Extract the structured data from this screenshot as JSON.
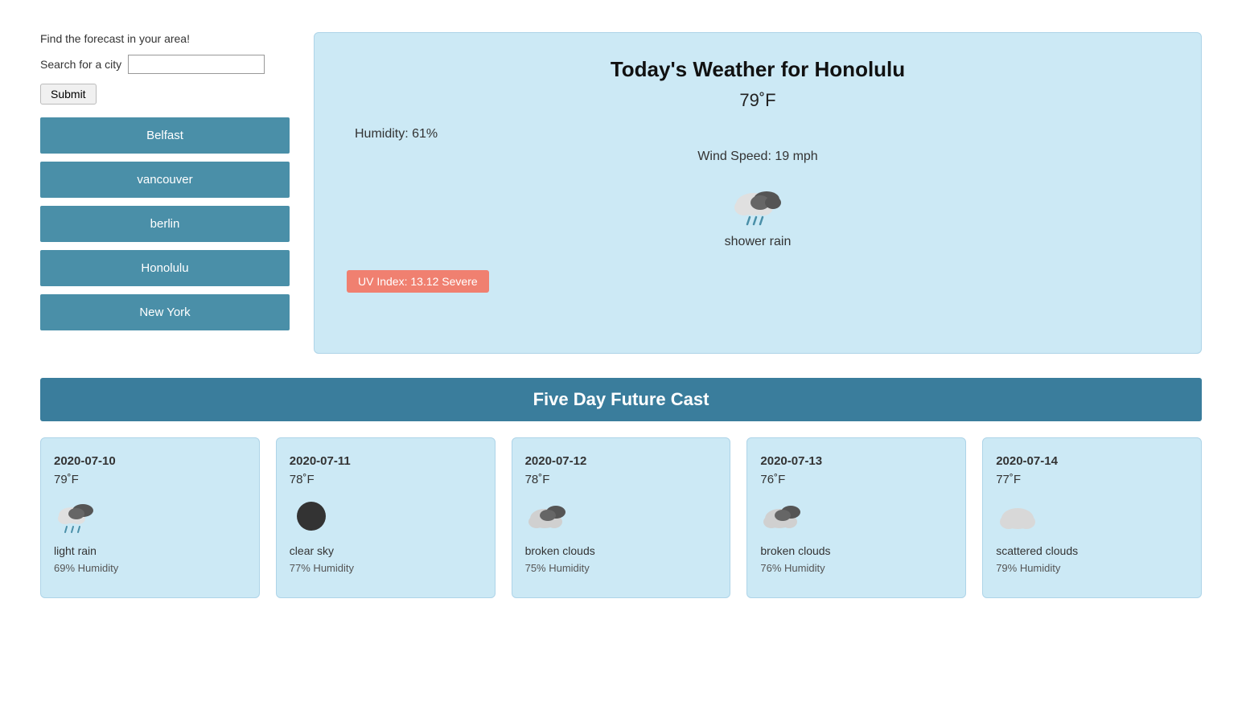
{
  "sidebar": {
    "title": "Find the forecast in your area!",
    "search_label": "Search for a city",
    "search_placeholder": "",
    "submit_label": "Submit",
    "cities": [
      {
        "label": "Belfast"
      },
      {
        "label": "vancouver"
      },
      {
        "label": "berlin"
      },
      {
        "label": "Honolulu"
      },
      {
        "label": "New York"
      }
    ]
  },
  "current_weather": {
    "title": "Today's Weather for Honolulu",
    "temp": "79˚F",
    "humidity": "Humidity: 61%",
    "wind_speed": "Wind Speed: 19 mph",
    "condition": "shower rain",
    "uv_badge": "UV Index: 13.12 Severe"
  },
  "five_day": {
    "header": "Five Day Future Cast",
    "forecasts": [
      {
        "date": "2020-07-10",
        "temp": "79˚F",
        "condition": "light rain",
        "humidity": "69% Humidity"
      },
      {
        "date": "2020-07-11",
        "temp": "78˚F",
        "condition": "clear sky",
        "humidity": "77% Humidity"
      },
      {
        "date": "2020-07-12",
        "temp": "78˚F",
        "condition": "broken clouds",
        "humidity": "75% Humidity"
      },
      {
        "date": "2020-07-13",
        "temp": "76˚F",
        "condition": "broken clouds",
        "humidity": "76% Humidity"
      },
      {
        "date": "2020-07-14",
        "temp": "77˚F",
        "condition": "scattered clouds",
        "humidity": "79% Humidity"
      }
    ]
  }
}
